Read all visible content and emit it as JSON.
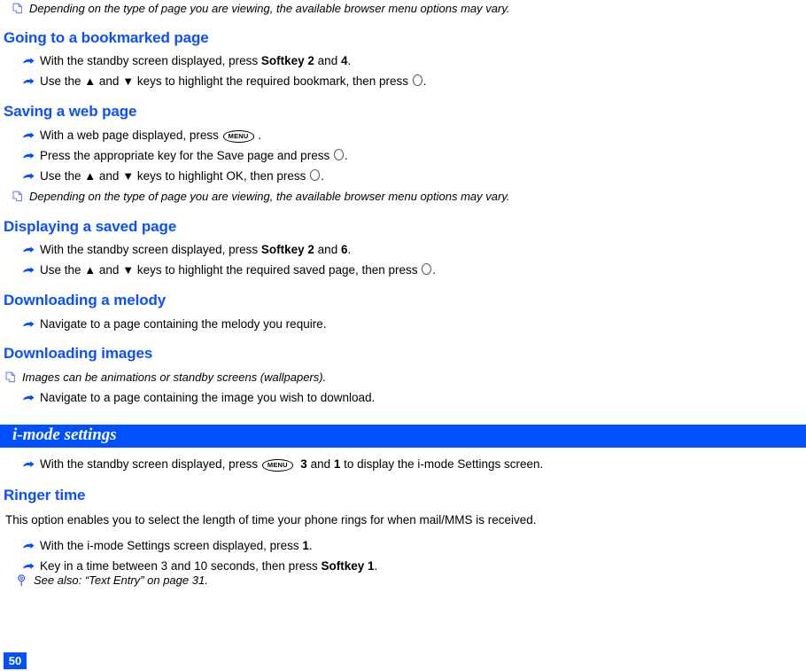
{
  "page": {
    "number": "50",
    "accent_color": "#0050ff",
    "heading_color": "#0b4ffd"
  },
  "icons": {
    "note": "note-page-icon",
    "bullet": "pointing-hand-bullet-icon",
    "see_also": "magnifier-key-icon",
    "menu_key": "MENU",
    "select_key": "center-select-key-icon",
    "arrow_up": "▲",
    "arrow_down": "▼"
  },
  "top_note": {
    "text": "Depending on the type of page you are viewing, the available browser menu options may vary."
  },
  "sections": [
    {
      "heading": "Going to a bookmarked page",
      "steps": [
        {
          "parts": [
            {
              "t": "With the standby screen displayed, press "
            },
            {
              "t": "Softkey 2",
              "bold": true
            },
            {
              "t": " and "
            },
            {
              "t": "4",
              "bold": true
            },
            {
              "t": "."
            }
          ]
        },
        {
          "parts": [
            {
              "t": "Use the "
            },
            {
              "t": "▲",
              "glyph": "arrow"
            },
            {
              "t": " and "
            },
            {
              "t": "▼",
              "glyph": "arrow"
            },
            {
              "t": " keys to highlight the required bookmark, then press "
            },
            {
              "t": "",
              "glyph": "circle"
            },
            {
              "t": "."
            }
          ]
        }
      ]
    },
    {
      "heading": "Saving a web page",
      "steps": [
        {
          "parts": [
            {
              "t": "With a web page displayed, press "
            },
            {
              "t": "MENU",
              "glyph": "menu"
            },
            {
              "t": " ."
            }
          ]
        },
        {
          "parts": [
            {
              "t": "Press the appropriate key for the Save page and press "
            },
            {
              "t": "",
              "glyph": "circle"
            },
            {
              "t": "."
            }
          ]
        },
        {
          "parts": [
            {
              "t": "Use the "
            },
            {
              "t": "▲",
              "glyph": "arrow"
            },
            {
              "t": " and "
            },
            {
              "t": "▼",
              "glyph": "arrow"
            },
            {
              "t": " keys to highlight OK, then press "
            },
            {
              "t": "",
              "glyph": "circle"
            },
            {
              "t": "."
            }
          ]
        }
      ],
      "note": "Depending on the type of page you are viewing, the available browser menu options may vary."
    },
    {
      "heading": "Displaying a saved page",
      "steps": [
        {
          "parts": [
            {
              "t": "With the standby screen displayed, press "
            },
            {
              "t": "Softkey 2",
              "bold": true
            },
            {
              "t": " and "
            },
            {
              "t": "6",
              "bold": true
            },
            {
              "t": "."
            }
          ]
        },
        {
          "parts": [
            {
              "t": "Use the "
            },
            {
              "t": "▲",
              "glyph": "arrow"
            },
            {
              "t": " and "
            },
            {
              "t": "▼",
              "glyph": "arrow"
            },
            {
              "t": " keys to highlight the required saved page, then press "
            },
            {
              "t": "",
              "glyph": "circle"
            },
            {
              "t": "."
            }
          ]
        }
      ]
    },
    {
      "heading": "Downloading a melody",
      "steps": [
        {
          "parts": [
            {
              "t": "Navigate to a page containing the melody you require."
            }
          ]
        }
      ]
    },
    {
      "heading": "Downloading images",
      "note_before": "Images can be animations or standby screens (wallpapers).",
      "steps": [
        {
          "parts": [
            {
              "t": "Navigate to a page containing the image you wish to download."
            }
          ]
        }
      ]
    }
  ],
  "banner": {
    "title": "i-mode settings"
  },
  "banner_section": {
    "intro_step": {
      "parts": [
        {
          "t": "With the standby screen displayed, press "
        },
        {
          "t": "MENU",
          "glyph": "menu"
        },
        {
          "t": "  "
        },
        {
          "t": "3",
          "bold": true
        },
        {
          "t": " and "
        },
        {
          "t": "1",
          "bold": true
        },
        {
          "t": " to display the i-mode Settings screen."
        }
      ]
    },
    "heading": "Ringer time",
    "paragraph": "This option enables you to select the length of time your phone rings for when mail/MMS is received.",
    "steps": [
      {
        "parts": [
          {
            "t": "With the i-mode Settings screen displayed, press "
          },
          {
            "t": "1",
            "bold": true
          },
          {
            "t": "."
          }
        ]
      },
      {
        "parts": [
          {
            "t": "Key in a time between 3 and 10 seconds, then press "
          },
          {
            "t": "Softkey 1",
            "bold": true
          },
          {
            "t": "."
          }
        ]
      }
    ],
    "see_also": "See also: “Text Entry” on page 31."
  }
}
